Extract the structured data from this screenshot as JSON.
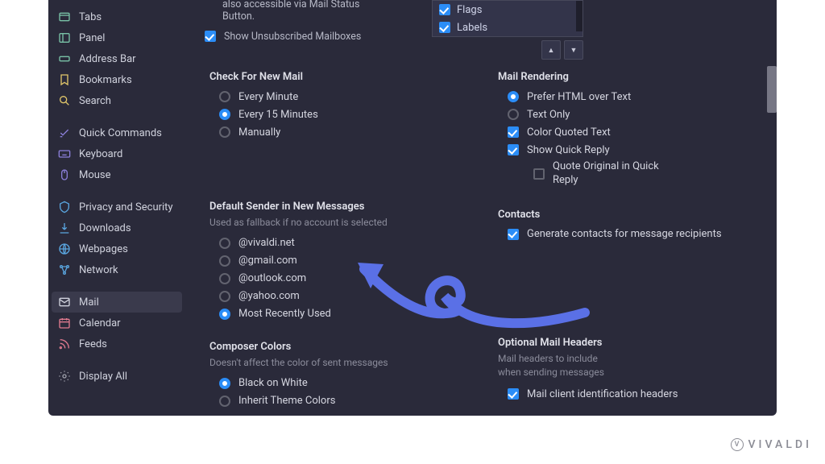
{
  "sidebar": {
    "items": [
      {
        "id": "tabs",
        "label": "Tabs"
      },
      {
        "id": "panel",
        "label": "Panel"
      },
      {
        "id": "addressbar",
        "label": "Address Bar"
      },
      {
        "id": "bookmarks",
        "label": "Bookmarks"
      },
      {
        "id": "search",
        "label": "Search"
      },
      {
        "gap": true
      },
      {
        "id": "quickcommands",
        "label": "Quick Commands"
      },
      {
        "id": "keyboard",
        "label": "Keyboard"
      },
      {
        "id": "mouse",
        "label": "Mouse"
      },
      {
        "gap": true
      },
      {
        "id": "privacy",
        "label": "Privacy and Security"
      },
      {
        "id": "downloads",
        "label": "Downloads"
      },
      {
        "id": "webpages",
        "label": "Webpages"
      },
      {
        "id": "network",
        "label": "Network"
      },
      {
        "gap": true
      },
      {
        "id": "mail",
        "label": "Mail",
        "active": true
      },
      {
        "id": "calendar",
        "label": "Calendar"
      },
      {
        "id": "feeds",
        "label": "Feeds"
      },
      {
        "gap": true
      },
      {
        "id": "displayall",
        "label": "Display All"
      }
    ]
  },
  "topArea": {
    "hint": "also accessible via Mail Status Button.",
    "show_unsub": "Show Unsubscribed Mailboxes",
    "flags_list": [
      "Flags",
      "Labels"
    ]
  },
  "left": {
    "check_title": "Check For New Mail",
    "check_opts": [
      "Every Minute",
      "Every 15 Minutes",
      "Manually"
    ],
    "check_selected": 1,
    "sender_title": "Default Sender in New Messages",
    "sender_sub": "Used as fallback if no account is selected",
    "sender_opts": [
      "@vivaldi.net",
      "@gmail.com",
      "@outlook.com",
      "@yahoo.com",
      "Most Recently Used"
    ],
    "sender_selected": 4,
    "composer_title": "Composer Colors",
    "composer_sub": "Doesn't affect the color of sent messages",
    "composer_opts": [
      "Black on White",
      "Inherit Theme Colors"
    ],
    "composer_selected": 0
  },
  "right": {
    "render_title": "Mail Rendering",
    "render_opts": [
      {
        "type": "radio",
        "label": "Prefer HTML over Text",
        "sel": true
      },
      {
        "type": "radio",
        "label": "Text Only",
        "sel": false
      },
      {
        "type": "chk",
        "label": "Color Quoted Text",
        "sel": true
      },
      {
        "type": "chk",
        "label": "Show Quick Reply",
        "sel": true
      },
      {
        "type": "chk",
        "label": "Quote Original in Quick Reply",
        "sel": false,
        "indent": true
      }
    ],
    "contacts_title": "Contacts",
    "contacts_opt": "Generate contacts for message recipients",
    "headers_title": "Optional Mail Headers",
    "headers_sub": "Mail headers to include\nwhen sending messages",
    "headers_opt": "Mail client identification headers"
  },
  "brand": "VIVALDI"
}
